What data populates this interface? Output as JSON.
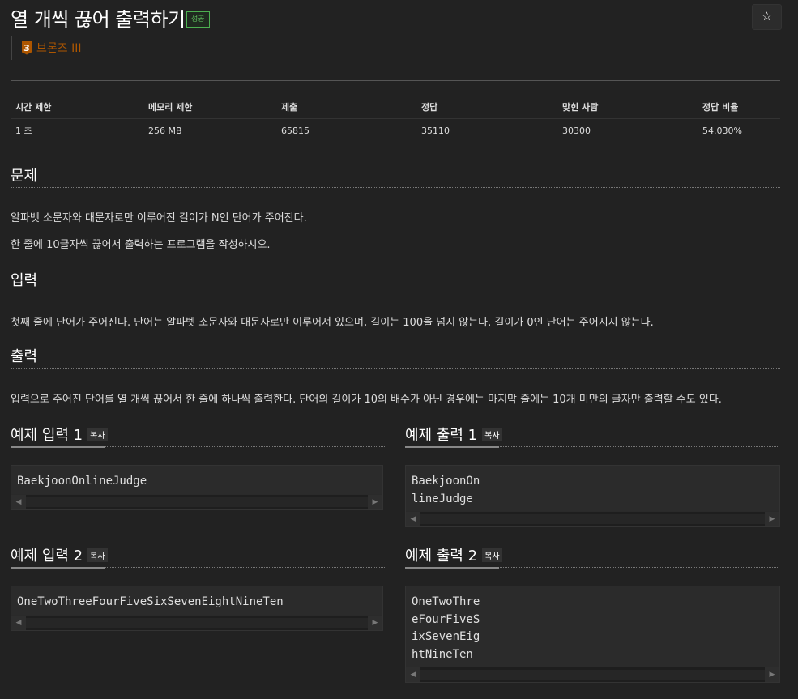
{
  "problem": {
    "title": "열 개씩 끊어 출력하기",
    "result_badge": "성공",
    "star_icon": "☆",
    "tier_number": "3",
    "tier_label": "브론즈 III"
  },
  "stats": {
    "headers": [
      "시간 제한",
      "메모리 제한",
      "제출",
      "정답",
      "맞힌 사람",
      "정답 비율"
    ],
    "values": [
      "1 초",
      "256 MB",
      "65815",
      "35110",
      "30300",
      "54.030%"
    ]
  },
  "sections": {
    "description": {
      "heading": "문제",
      "lines": [
        "알파벳 소문자와 대문자로만 이루어진 길이가 N인 단어가 주어진다.",
        "한 줄에 10글자씩 끊어서 출력하는 프로그램을 작성하시오."
      ]
    },
    "input": {
      "heading": "입력",
      "text": "첫째 줄에 단어가 주어진다. 단어는 알파벳 소문자와 대문자로만 이루어져 있으며, 길이는 100을 넘지 않는다. 길이가 0인 단어는 주어지지 않는다."
    },
    "output": {
      "heading": "출력",
      "text": "입력으로 주어진 단어를 열 개씩 끊어서 한 줄에 하나씩 출력한다. 단어의 길이가 10의 배수가 아닌 경우에는 마지막 줄에는 10개 미만의 글자만 출력할 수도 있다."
    }
  },
  "samples": {
    "copy_label": "복사",
    "input1": {
      "heading": "예제 입력 1",
      "text": "BaekjoonOnlineJudge"
    },
    "output1": {
      "heading": "예제 출력 1",
      "text": "BaekjoonOn\nlineJudge"
    },
    "input2": {
      "heading": "예제 입력 2",
      "text": "OneTwoThreeFourFiveSixSevenEightNineTen"
    },
    "output2": {
      "heading": "예제 출력 2",
      "text": "OneTwoThre\neFourFiveS\nixSevenEig\nhtNineTen"
    }
  },
  "colors": {
    "background": "#222222",
    "bronze": "#ad5600",
    "success": "#5cb85c"
  }
}
